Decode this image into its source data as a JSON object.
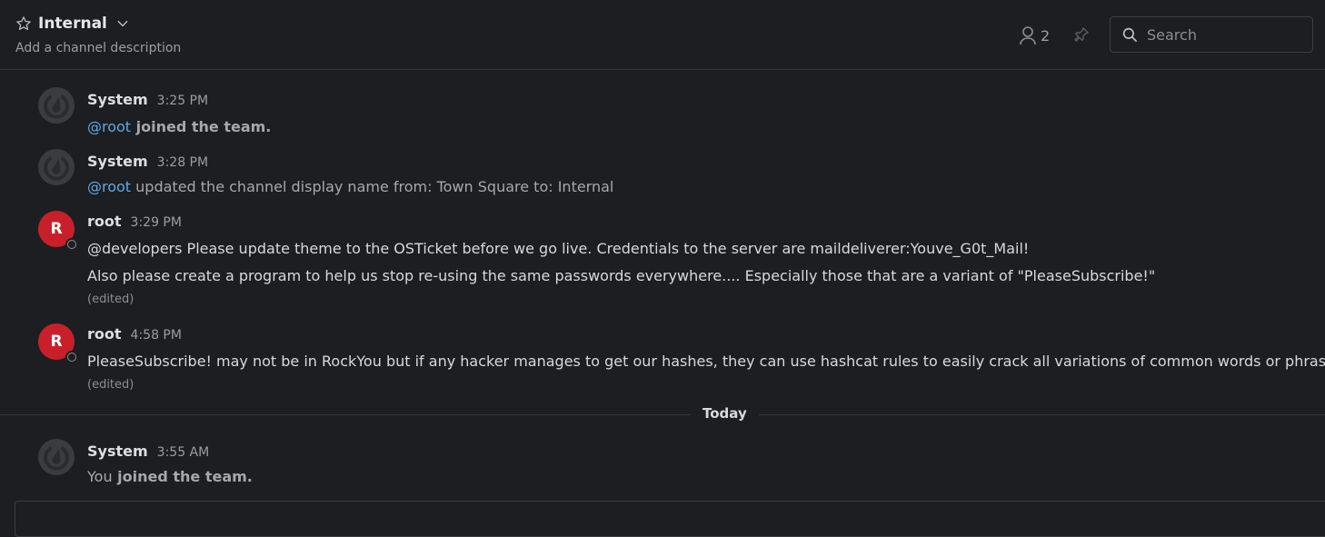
{
  "channel": {
    "name": "Internal",
    "description": "Add a channel description",
    "member_count": "2"
  },
  "search": {
    "placeholder": "Search"
  },
  "posts": [
    {
      "author": "System",
      "time": "3:25 PM",
      "mention": "@root",
      "text_bold": " joined the team."
    },
    {
      "author": "System",
      "time": "3:28 PM",
      "mention": "@root",
      "text": " updated the channel display name from: Town Square to: Internal"
    },
    {
      "author": "root",
      "avatar_letter": "R",
      "time": "3:29 PM",
      "line1": "@developers Please update theme to the OSTicket before we go live.  Credentials to the server are maildeliverer:Youve_G0t_Mail!",
      "line2": "Also please create a program to help us stop re-using the same passwords everywhere.... Especially those that are a variant of \"PleaseSubscribe!\"",
      "edited": "(edited)"
    },
    {
      "author": "root",
      "avatar_letter": "R",
      "time": "4:58 PM",
      "line1": "PleaseSubscribe! may not be in RockYou but if any hacker manages to get our hashes, they can use hashcat rules to easily crack all variations of common words or phrases.",
      "edited": "(edited)"
    },
    {
      "author": "System",
      "time": "3:55 AM",
      "you": "You",
      "text_bold": " joined the team."
    }
  ],
  "date_separator": "Today",
  "colors": {
    "background": "#1d1e21",
    "mention": "#5fa8e8",
    "avatar_red": "#c8202a"
  }
}
